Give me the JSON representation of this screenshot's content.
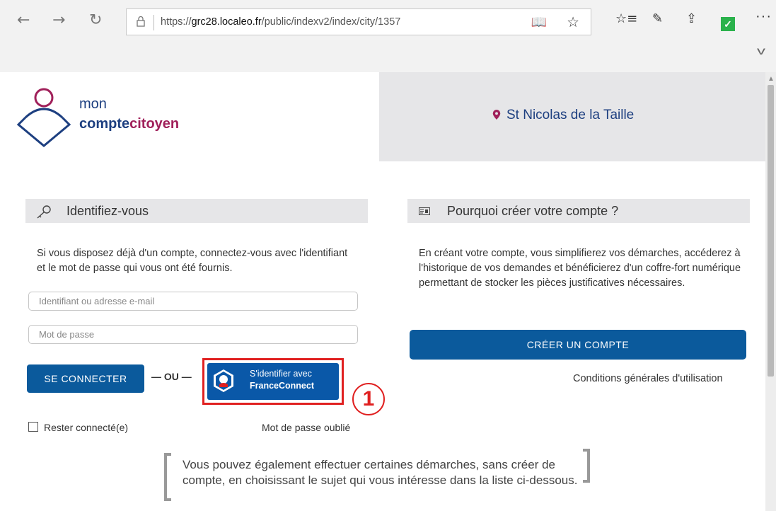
{
  "browser": {
    "back_icon": "←",
    "forward_icon": "→",
    "refresh_icon": "↻",
    "url_prefix": "https://",
    "url_host": "grc28.localeo.fr",
    "url_path": "/public/indexv2/index/city/1357",
    "reading_icon": "📖",
    "star_icon": "☆",
    "favorites_icon": "☆≡",
    "pen_icon": "✎",
    "share_icon": "⇪",
    "more_icon": "···",
    "chevron_icon": "v"
  },
  "header": {
    "logo_line1": "mon",
    "logo_line2a": "compte",
    "logo_line2b": "citoyen",
    "city": "St Nicolas de la Taille",
    "colors": {
      "brand_blue": "#1d3f80",
      "brand_purple": "#a0205a"
    }
  },
  "login": {
    "title": "Identifiez-vous",
    "intro": "Si vous disposez déjà d'un compte, connectez-vous avec l'identifiant et le mot de passe qui vous ont été fournis.",
    "login_placeholder": "Identifiant ou adresse e-mail",
    "password_placeholder": "Mot de passe",
    "connect_label": "SE CONNECTER",
    "or_label": "— OU —",
    "fc_line1": "S'identifier avec",
    "fc_line2": "FranceConnect",
    "callout_number": "1",
    "remember_label": "Rester connecté(e)",
    "forgot_label": "Mot de passe oublié"
  },
  "why": {
    "title": "Pourquoi créer votre compte ?",
    "text": "En créant votre compte, vous simplifierez vos démarches, accéderez à l'historique de vos demandes et bénéficierez d'un coffre-fort numérique permettant de stocker les pièces justificatives nécessaires.",
    "create_label": "CRÉER UN COMPTE",
    "cgu_label": "Conditions générales d'utilisation"
  },
  "note": {
    "text": "Vous pouvez également effectuer certaines démarches, sans créer de compte, en choisissant le sujet qui vous intéresse dans la liste ci-dessous."
  }
}
